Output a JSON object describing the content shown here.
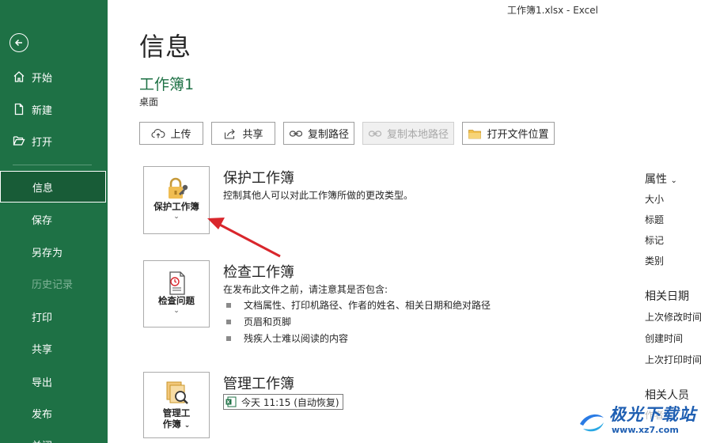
{
  "window": {
    "title": "工作簿1.xlsx  -  Excel"
  },
  "sidebar": {
    "items": [
      {
        "label": "开始",
        "icon": "home-icon"
      },
      {
        "label": "新建",
        "icon": "new-document-icon"
      },
      {
        "label": "打开",
        "icon": "open-folder-icon"
      },
      {
        "label": "信息",
        "active": true
      },
      {
        "label": "保存"
      },
      {
        "label": "另存为"
      },
      {
        "label": "历史记录",
        "disabled": true
      },
      {
        "label": "打印"
      },
      {
        "label": "共享"
      },
      {
        "label": "导出"
      },
      {
        "label": "发布"
      },
      {
        "label": "关闭"
      }
    ]
  },
  "main": {
    "title": "信息",
    "workbook_name": "工作簿1",
    "location": "桌面",
    "toolbar": {
      "upload": "上传",
      "share": "共享",
      "copy_path": "复制路径",
      "copy_local_path": "复制本地路径",
      "open_location": "打开文件位置"
    },
    "protect": {
      "button": "保护工作簿",
      "title": "保护工作簿",
      "desc": "控制其他人可以对此工作簿所做的更改类型。"
    },
    "inspect": {
      "button": "检查问题",
      "title": "检查工作簿",
      "desc": "在发布此文件之前，请注意其是否包含:",
      "bullets": [
        "文档属性、打印机路径、作者的姓名、相关日期和绝对路径",
        "页眉和页脚",
        "残疾人士难以阅读的内容"
      ]
    },
    "manage": {
      "button_line1": "管理工",
      "button_line2": "作簿",
      "title": "管理工作簿",
      "version": "今天 11:15 (自动恢复)"
    }
  },
  "properties": {
    "header": "属性",
    "items": [
      "大小",
      "标题",
      "标记",
      "类别"
    ],
    "dates_header": "相关日期",
    "dates": [
      "上次修改时间",
      "创建时间",
      "上次打印时间"
    ],
    "people_header": "相关人员",
    "people": [
      "作者"
    ]
  },
  "watermark": {
    "name": "极光下载站",
    "url": "www.xz7.com"
  },
  "colors": {
    "sidebar": "#1e7145",
    "accent": "#1e7145",
    "arrow": "#d9262c"
  }
}
